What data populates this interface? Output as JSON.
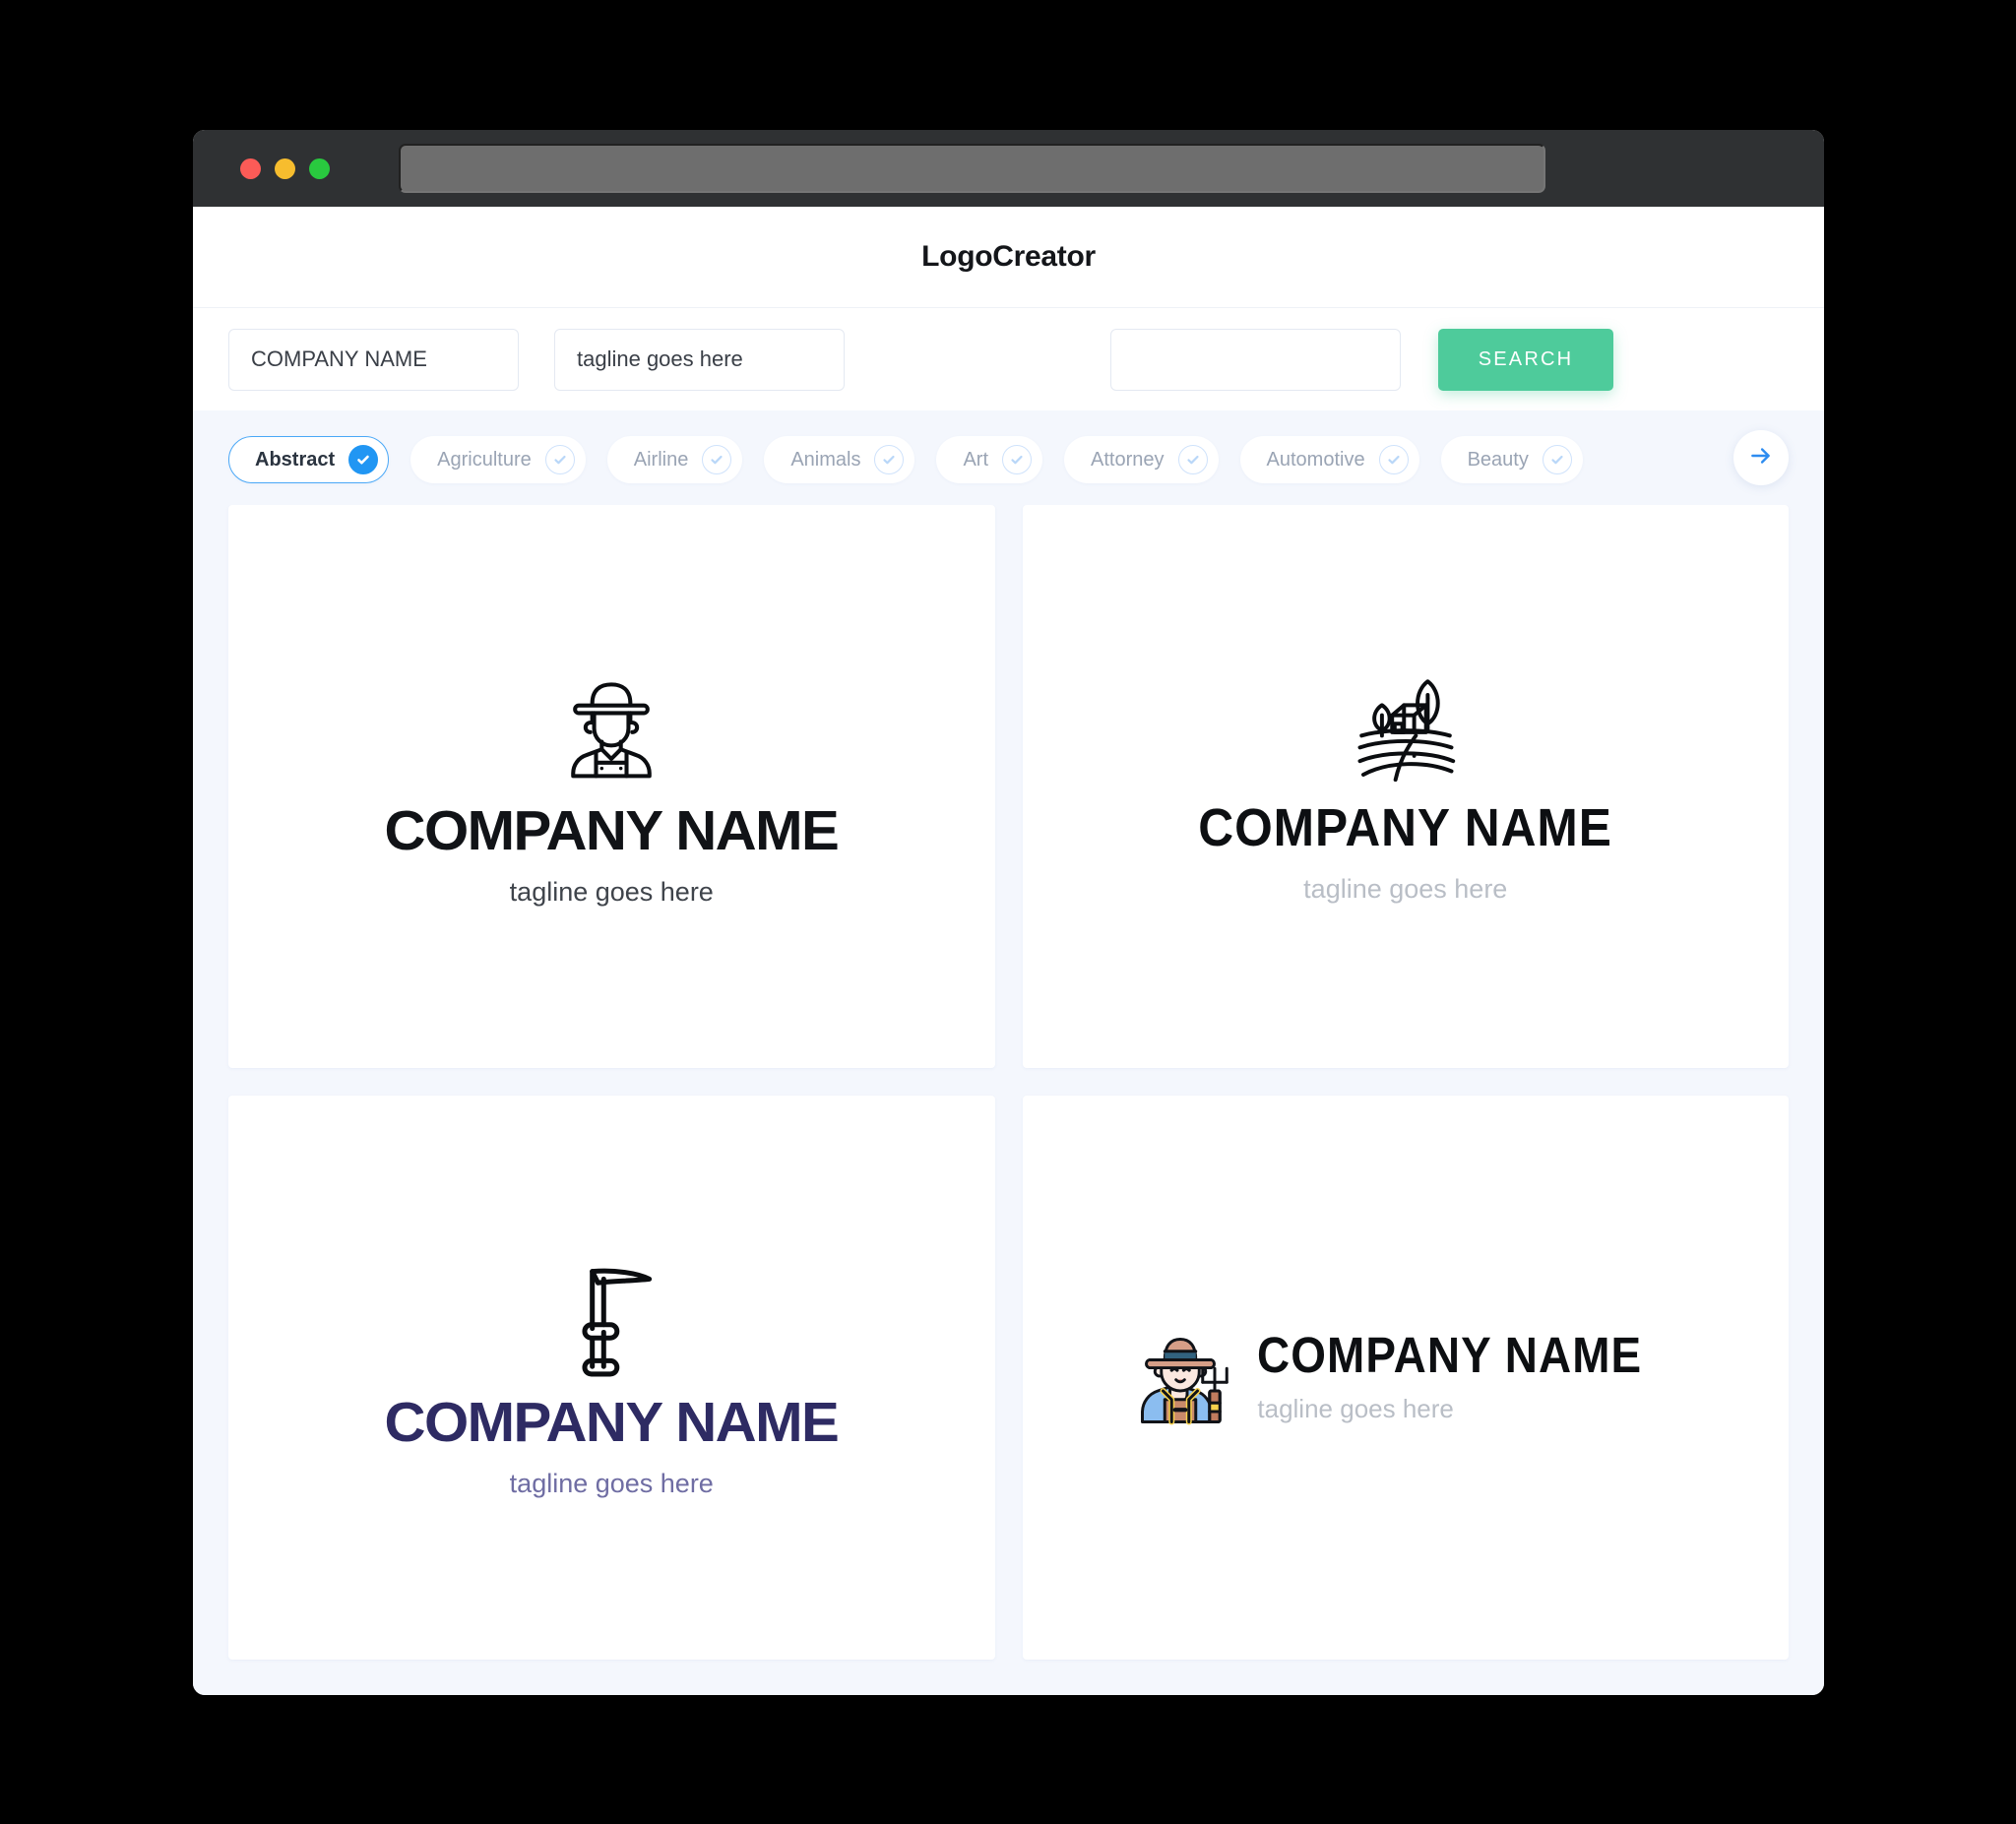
{
  "window": {
    "traffic_lights": [
      "close",
      "minimize",
      "maximize"
    ],
    "url_value": "",
    "url_placeholder": ""
  },
  "header": {
    "title": "LogoCreator"
  },
  "search": {
    "company_value": "COMPANY NAME",
    "company_placeholder": "COMPANY NAME",
    "tagline_value": "tagline goes here",
    "tagline_placeholder": "tagline goes here",
    "keyword_value": "",
    "keyword_placeholder": "",
    "button_label": "SEARCH",
    "button_color": "#4ecb9b"
  },
  "categories": {
    "next_arrow_icon": "arrow-right-icon",
    "accent_color": "#2196f3",
    "items": [
      {
        "label": "Abstract",
        "selected": true
      },
      {
        "label": "Agriculture",
        "selected": false
      },
      {
        "label": "Airline",
        "selected": false
      },
      {
        "label": "Animals",
        "selected": false
      },
      {
        "label": "Art",
        "selected": false
      },
      {
        "label": "Attorney",
        "selected": false
      },
      {
        "label": "Automotive",
        "selected": false
      },
      {
        "label": "Beauty",
        "selected": false
      }
    ]
  },
  "results": {
    "cards": [
      {
        "icon": "farmer-outline-icon",
        "name": "COMPANY NAME",
        "tagline": "tagline goes here",
        "name_color": "#111317",
        "tagline_color": "#3f444b"
      },
      {
        "icon": "farm-landscape-icon",
        "name": "COMPANY NAME",
        "tagline": "tagline goes here",
        "name_color": "#0d0f12",
        "tagline_color": "#b9bec6"
      },
      {
        "icon": "scythe-icon",
        "name": "COMPANY NAME",
        "tagline": "tagline goes here",
        "name_color": "#2e2b63",
        "tagline_color": "#6f6da3"
      },
      {
        "icon": "farmer-color-icon",
        "name": "COMPANY NAME",
        "tagline": "tagline goes here",
        "name_color": "#0d0f12",
        "tagline_color": "#b9bec6"
      }
    ]
  }
}
